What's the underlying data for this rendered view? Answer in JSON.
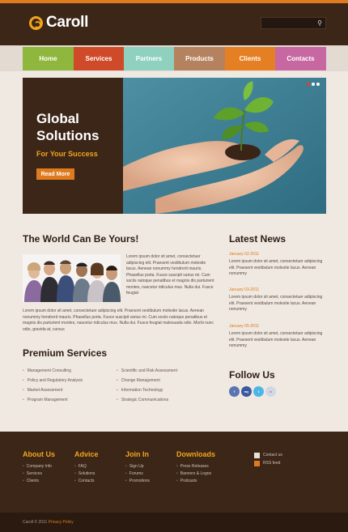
{
  "header": {
    "logo_text": "Caroll",
    "search_placeholder": "",
    "search_icon": "magnifier-icon"
  },
  "nav": {
    "items": [
      {
        "label": "Home",
        "color": "#8fb73d"
      },
      {
        "label": "Services",
        "color": "#cf4a28"
      },
      {
        "label": "Partners",
        "color": "#8fd0bf"
      },
      {
        "label": "Products",
        "color": "#b5825f"
      },
      {
        "label": "Clients",
        "color": "#e57f23"
      },
      {
        "label": "Contacts",
        "color": "#c768a3"
      }
    ]
  },
  "slider": {
    "title": "Global Solutions",
    "subtitle": "For Your Success",
    "button_label": "Read More",
    "image": "hands-holding-seedling-image",
    "dots": 3,
    "active_dot": 0
  },
  "intro": {
    "heading": "The World Can Be Yours!",
    "image": "business-team-photo",
    "side_text": "Lorem ipsum dolor sit amet, consectetuer adipiscing elit. Praesent vestibulum molestie lacus. Aenean nonummy hendrerit mauris. Phasellus porta. Fusce suscipit varius mi. Cum sociis natoque penatibus et magnis dis parturient montes, nascetur ridiculus mus. Nulla dui. Fusce feugiat",
    "body_text": "Lorem ipsum dolor sit amet, consectetuer adipiscing elit. Praesent vestibulum molestie lacus. Aenean nonummy hendrerit mauris. Phasellus porta. Fusce suscipit varius mi. Cum sociis natoque penatibus et magnis dis parturient montes, nascetur ridiculus mus. Nulla dui. Fusce feugiat malesuada odio. Morbi nunc odio, gravida at, cursus"
  },
  "services": {
    "heading": "Premium Services",
    "left": [
      "Management Consulting",
      "Policy and Regulatory Analysis",
      "Market Assessment",
      "Program Management"
    ],
    "right": [
      "Scientific and Risk Assessment",
      "Change Management",
      "Information Technology",
      "Strategic Communications"
    ]
  },
  "news": {
    "heading": "Latest News",
    "items": [
      {
        "date": "January 02-2011",
        "text": "Lorem ipsum dolor sit amet, consectetuer adipiscing elit. Praesent vestibulum molestie lacus. Aenean nonummy"
      },
      {
        "date": "January 03-2011",
        "text": "Lorem ipsum dolor sit amet, consectetuer adipiscing elit. Praesent vestibulum molestie lacus. Aenean nonummy"
      },
      {
        "date": "January 05-2011",
        "text": "Lorem ipsum dolor sit amet, consectetuer adipiscing elit. Praesent vestibulum molestie lacus. Aenean nonummy"
      }
    ]
  },
  "follow": {
    "heading": "Follow Us",
    "icons": [
      {
        "name": "facebook-icon",
        "glyph": "f",
        "color": "#5a74b2"
      },
      {
        "name": "myspace-icon",
        "glyph": "my",
        "color": "#3a5aa0"
      },
      {
        "name": "twitter-icon",
        "glyph": "t",
        "color": "#4db6e6"
      },
      {
        "name": "flickr-icon",
        "glyph": "••",
        "color": "#d0d8e6"
      }
    ]
  },
  "footer": {
    "columns": [
      {
        "title": "About Us",
        "links": [
          "Company Info",
          "Services",
          "Clients"
        ]
      },
      {
        "title": "Advice",
        "links": [
          "FAQ",
          "Solutions",
          "Contacts"
        ]
      },
      {
        "title": "Join In",
        "links": [
          "Sign Up",
          "Forums",
          "Promotions"
        ]
      },
      {
        "title": "Downloads",
        "links": [
          "Press Releases",
          "Banners & Logos",
          "Podcasts"
        ]
      }
    ],
    "contact": [
      {
        "label": "Contact us",
        "icon": "envelope-icon"
      },
      {
        "label": "RSS feed",
        "icon": "rss-icon"
      }
    ],
    "copyright": "Caroll © 2011",
    "privacy": "Privacy Policy"
  }
}
